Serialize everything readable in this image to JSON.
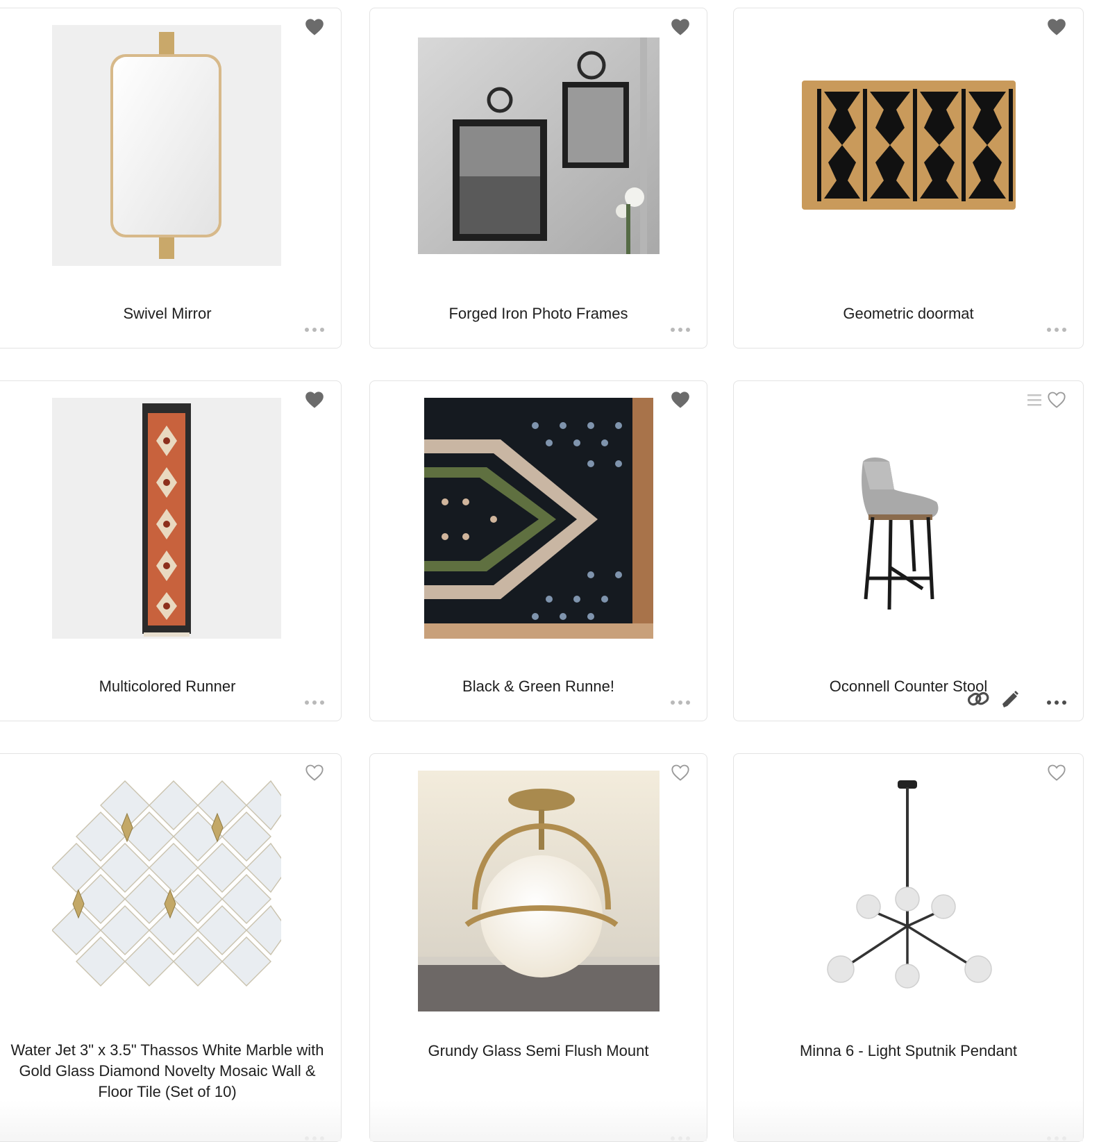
{
  "products": [
    {
      "title": "Swivel Mirror",
      "favorited": true
    },
    {
      "title": "Forged Iron Photo Frames",
      "favorited": true
    },
    {
      "title": "Geometric doormat",
      "favorited": true
    },
    {
      "title": "Multicolored Runner",
      "favorited": true
    },
    {
      "title": "Black & Green Runne!",
      "favorited": true
    },
    {
      "title": "Oconnell Counter Stool",
      "favorited": false
    },
    {
      "title": "Water Jet 3\" x 3.5\" Thassos White Marble with Gold Glass Diamond Novelty Mosaic Wall & Floor Tile (Set of 10)",
      "favorited": false
    },
    {
      "title": "Grundy Glass Semi Flush Mount",
      "favorited": false
    },
    {
      "title": "Minna 6 - Light Sputnik Pendant",
      "favorited": false
    }
  ],
  "icons": {
    "favorite": "heart-filled-icon",
    "unfavorite": "heart-outline-icon",
    "more": "more-dots-icon",
    "link": "link-icon",
    "edit": "pencil-icon",
    "menu": "list-icon"
  },
  "colors": {
    "heart_filled": "#6b6b6b",
    "heart_outline": "#9a9a9a",
    "card_border": "#e3e3e3"
  }
}
